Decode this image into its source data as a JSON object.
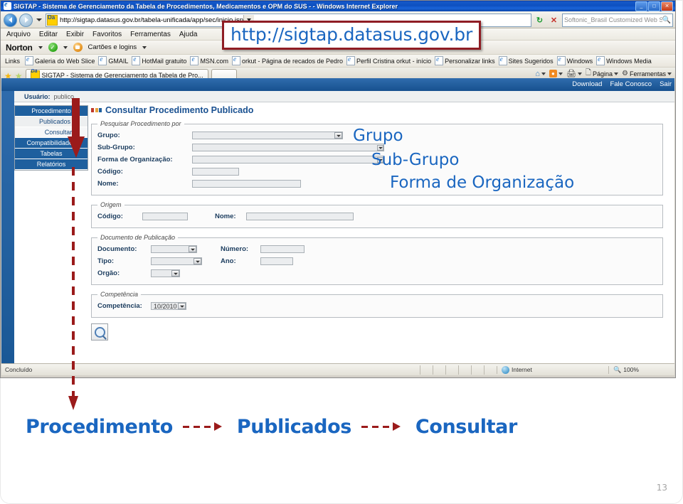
{
  "window": {
    "title": "SIGTAP - Sistema de Gerenciamento da Tabela de Procedimentos, Medicamentos e OPM do SUS - - Windows Internet Explorer",
    "minimize_label": "_",
    "maximize_label": "□",
    "close_label": "✕"
  },
  "nav": {
    "url": "http://sigtap.datasus.gov.br/tabela-unificada/app/sec/inicio.jsp",
    "refresh_label": "↻",
    "stop_label": "✕",
    "search_placeholder": "Softonic_Brasil Customized Web Search"
  },
  "menubar": {
    "items": [
      "Arquivo",
      "Editar",
      "Exibir",
      "Favoritos",
      "Ferramentas",
      "Ajuda"
    ]
  },
  "norton": {
    "logo": "Norton",
    "cards_label": "Cartões e logins"
  },
  "links_bar": {
    "label": "Links",
    "items": [
      "Galeria do Web Slice",
      "GMAIL",
      "HotMail gratuito",
      "MSN.com",
      "orkut - Página de recados de Pedro",
      "Perfil Cristina orkut - início",
      "Personalizar links",
      "Sites Sugeridos",
      "Windows",
      "Windows Media"
    ]
  },
  "tabbar": {
    "tab_label": "SIGTAP - Sistema de Gerenciamento da Tabela de Pro...",
    "right_items": [
      "Página",
      "Ferramentas"
    ]
  },
  "page": {
    "topbar_links": [
      "Download",
      "Fale Conosco",
      "Sair"
    ],
    "user_label": "Usuário:",
    "user_value": "publico",
    "heading": "Consultar Procedimento Publicado",
    "menu": [
      {
        "label": "Procedimento",
        "level": 0
      },
      {
        "label": "Publicados",
        "level": 1
      },
      {
        "label": "Consultar",
        "level": 2
      },
      {
        "label": "Compatibilidades",
        "level": 0
      },
      {
        "label": "Tabelas",
        "level": 0
      },
      {
        "label": "Relatórios",
        "level": 0
      }
    ],
    "panel_pesquisar": {
      "legend": "Pesquisar Procedimento por",
      "grupo_label": "Grupo:",
      "grupo_value": "",
      "subgrupo_label": "Sub-Grupo:",
      "subgrupo_value": "",
      "forma_label": "Forma de Organização:",
      "forma_value": "",
      "codigo_label": "Código:",
      "codigo_value": "",
      "nome_label": "Nome:",
      "nome_value": ""
    },
    "panel_origem": {
      "legend": "Origem",
      "codigo_label": "Código:",
      "codigo_value": "",
      "nome_label": "Nome:",
      "nome_value": ""
    },
    "panel_documento": {
      "legend": "Documento de Publicação",
      "documento_label": "Documento:",
      "documento_value": "",
      "numero_label": "Número:",
      "numero_value": "",
      "tipo_label": "Tipo:",
      "tipo_value": "",
      "ano_label": "Ano:",
      "ano_value": "",
      "orgao_label": "Orgão:",
      "orgao_value": ""
    },
    "panel_competencia": {
      "legend": "Competência",
      "competencia_label": "Competência:",
      "competencia_value": "10/2010"
    },
    "search_button_title": "Pesquisar"
  },
  "statusbar": {
    "text": "Concluído",
    "zone": "Internet",
    "zoom": "100%"
  },
  "annotations": {
    "callout_url": "http://sigtap.datasus.gov.br",
    "grupo": "Grupo",
    "subgrupo": "Sub-Grupo",
    "forma": "Forma de Organização",
    "flow": [
      "Procedimento",
      "Publicados",
      "Consultar"
    ]
  },
  "slide": {
    "page_number": "13"
  },
  "colors": {
    "accent_blue": "#1a66c0",
    "annotation_red": "#9b1b1b",
    "menu_blue": "#1e5f9e",
    "heading_blue": "#1a5191"
  }
}
